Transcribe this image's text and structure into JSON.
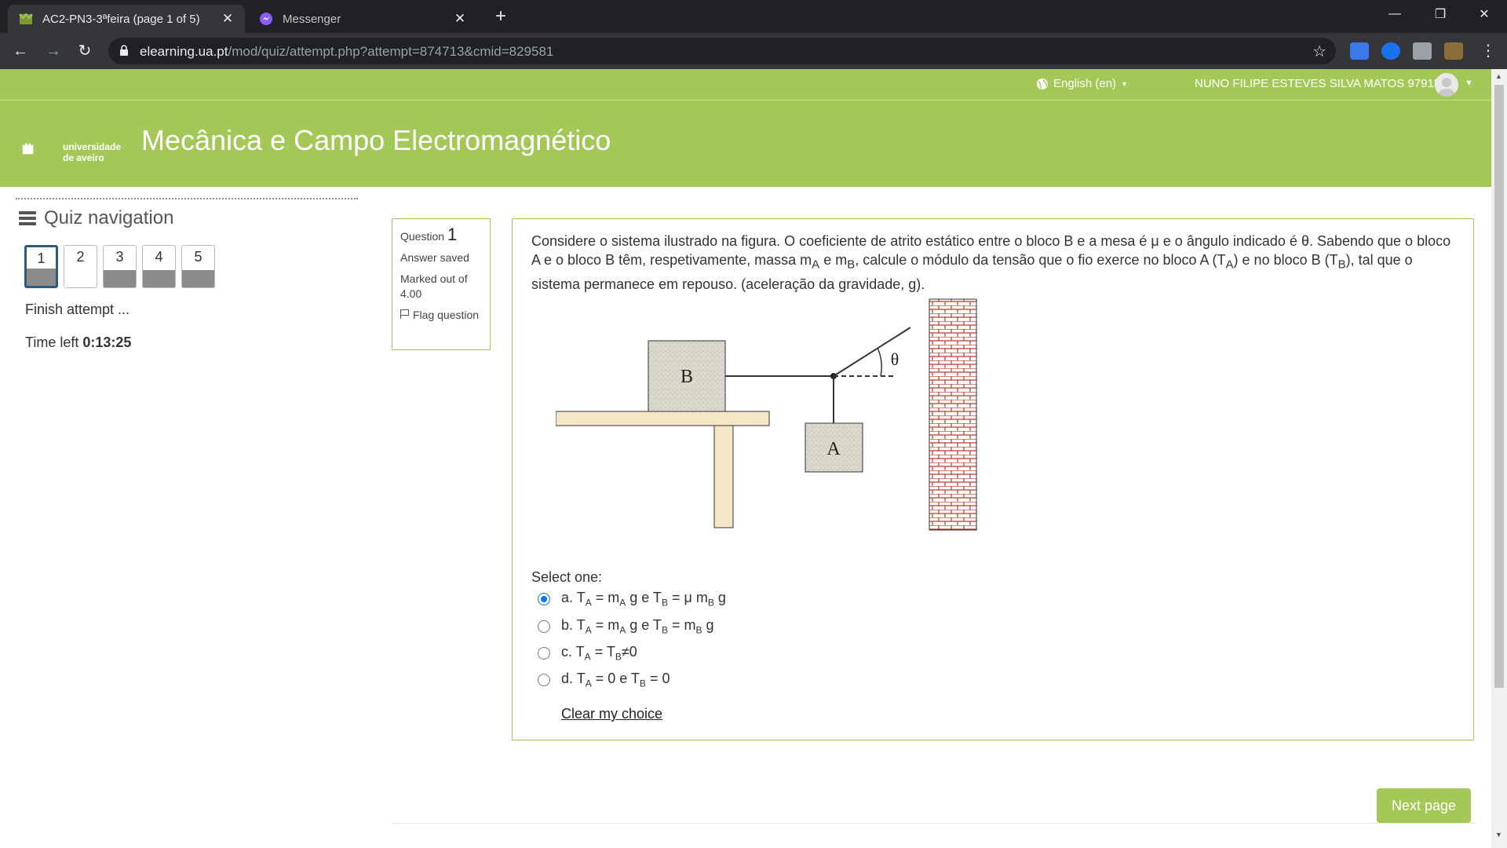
{
  "browser": {
    "tabs": [
      {
        "title": "AC2-PN3-3ªfeira (page 1 of 5)",
        "close": "✕",
        "active": true
      },
      {
        "title": "Messenger",
        "close": "✕",
        "active": false
      }
    ],
    "new_tab": "+",
    "url_host": "elearning.ua.pt",
    "url_path": "/mod/quiz/attempt.php?attempt=874713&cmid=829581"
  },
  "topnav": {
    "language": "English (en)",
    "user_name": "NUNO FILIPE ESTEVES SILVA MATOS 97915"
  },
  "header": {
    "logo_line1": "universidade",
    "logo_line2": "de aveiro",
    "course_title": "Mecânica e Campo Electromagnético"
  },
  "quiz_nav": {
    "title": "Quiz navigation",
    "questions": [
      "1",
      "2",
      "3",
      "4",
      "5"
    ],
    "finish": "Finish attempt ...",
    "time_label": "Time left",
    "time_value": "0:13:25"
  },
  "question_info": {
    "label": "Question",
    "number": "1",
    "state": "Answer saved",
    "marks": "Marked out of 4.00",
    "flag": "Flag question"
  },
  "question": {
    "text_parts": {
      "p1": "Considere o sistema ilustrado na figura. O coeficiente de atrito estático entre o bloco B e a mesa é μ e o ângulo indicado é θ. Sabendo que o bloco A e o bloco B têm, respetivamente, massa m",
      "sA": "A",
      "p2": " e m",
      "sB": "B",
      "p3": ", calcule o módulo da tensão que o fio exerce no bloco A (T",
      "p4": ") e no bloco B (T",
      "p5": "), tal que o sistema permanece em repouso. (aceleração da gravidade, g)."
    },
    "figure_labels": {
      "block_b": "B",
      "block_a": "A",
      "angle": "θ"
    },
    "select_one": "Select one:",
    "options": [
      {
        "prefix": "a. T",
        "s1": "A",
        "m1": " = m",
        "s2": "A",
        "m2": " g e T",
        "s3": "B",
        "m3": " = μ m",
        "s4": "B",
        "m4": " g",
        "selected": true
      },
      {
        "prefix": "b. T",
        "s1": "A",
        "m1": " = m",
        "s2": "A",
        "m2": " g e T",
        "s3": "B",
        "m3": " = m",
        "s4": "B",
        "m4": " g",
        "selected": false
      },
      {
        "prefix": "c. T",
        "s1": "A",
        "m1": " = T",
        "s2": "B",
        "m2": "≠0",
        "selected": false
      },
      {
        "prefix": "d. T",
        "s1": "A",
        "m1": " = 0 e T",
        "s2": "B",
        "m2": " = 0",
        "selected": false
      }
    ],
    "clear": "Clear my choice"
  },
  "next_page": "Next page",
  "colors": {
    "brand_green": "#a4c857",
    "radio_blue": "#0075ff",
    "nav_dark": "#2f5c7e"
  }
}
